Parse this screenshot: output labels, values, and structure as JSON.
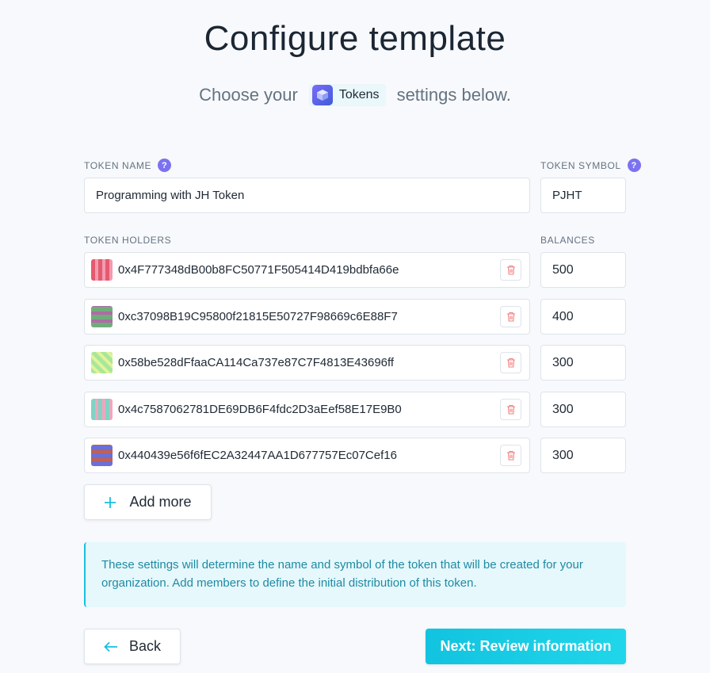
{
  "header": {
    "title": "Configure template",
    "subtitle_before": "Choose your",
    "template_name": "Tokens",
    "subtitle_after": "settings below."
  },
  "token_name": {
    "label": "TOKEN NAME",
    "value": "Programming with JH Token"
  },
  "token_symbol": {
    "label": "TOKEN SYMBOL",
    "value": "PJHT"
  },
  "holders": {
    "label": "TOKEN HOLDERS",
    "balances_label": "BALANCES",
    "rows": [
      {
        "address": "0x4F777348dB00b8FC50771F505414D419bdbfa66e",
        "balance": "500"
      },
      {
        "address": "0xc37098B19C95800f21815E50727F98669c6E88F7",
        "balance": "400"
      },
      {
        "address": "0x58be528dFfaaCA114Ca737e87C7F4813E43696ff",
        "balance": "300"
      },
      {
        "address": "0x4c7587062781DE69DB6F4fdc2D3aEef58E17E9B0",
        "balance": "300"
      },
      {
        "address": "0x440439e56f6fEC2A32447AA1D677757Ec07Cef16",
        "balance": "300"
      }
    ],
    "add_more_label": "Add more"
  },
  "info_text": "These settings will determine the name and symbol of the token that will be created for your organization. Add members to define the initial distribution of this token.",
  "footer": {
    "back_label": "Back",
    "next_label": "Next: Review information"
  },
  "colors": {
    "accent": "#18bfe0",
    "help_badge": "#7c72f0",
    "trash": "#f07f7f",
    "info_bg": "#e6f8fc",
    "info_text": "#1e8aa3"
  },
  "icons": [
    "help-icon",
    "tokens-cube-icon",
    "trash-icon",
    "plus-icon",
    "arrow-left-icon"
  ]
}
